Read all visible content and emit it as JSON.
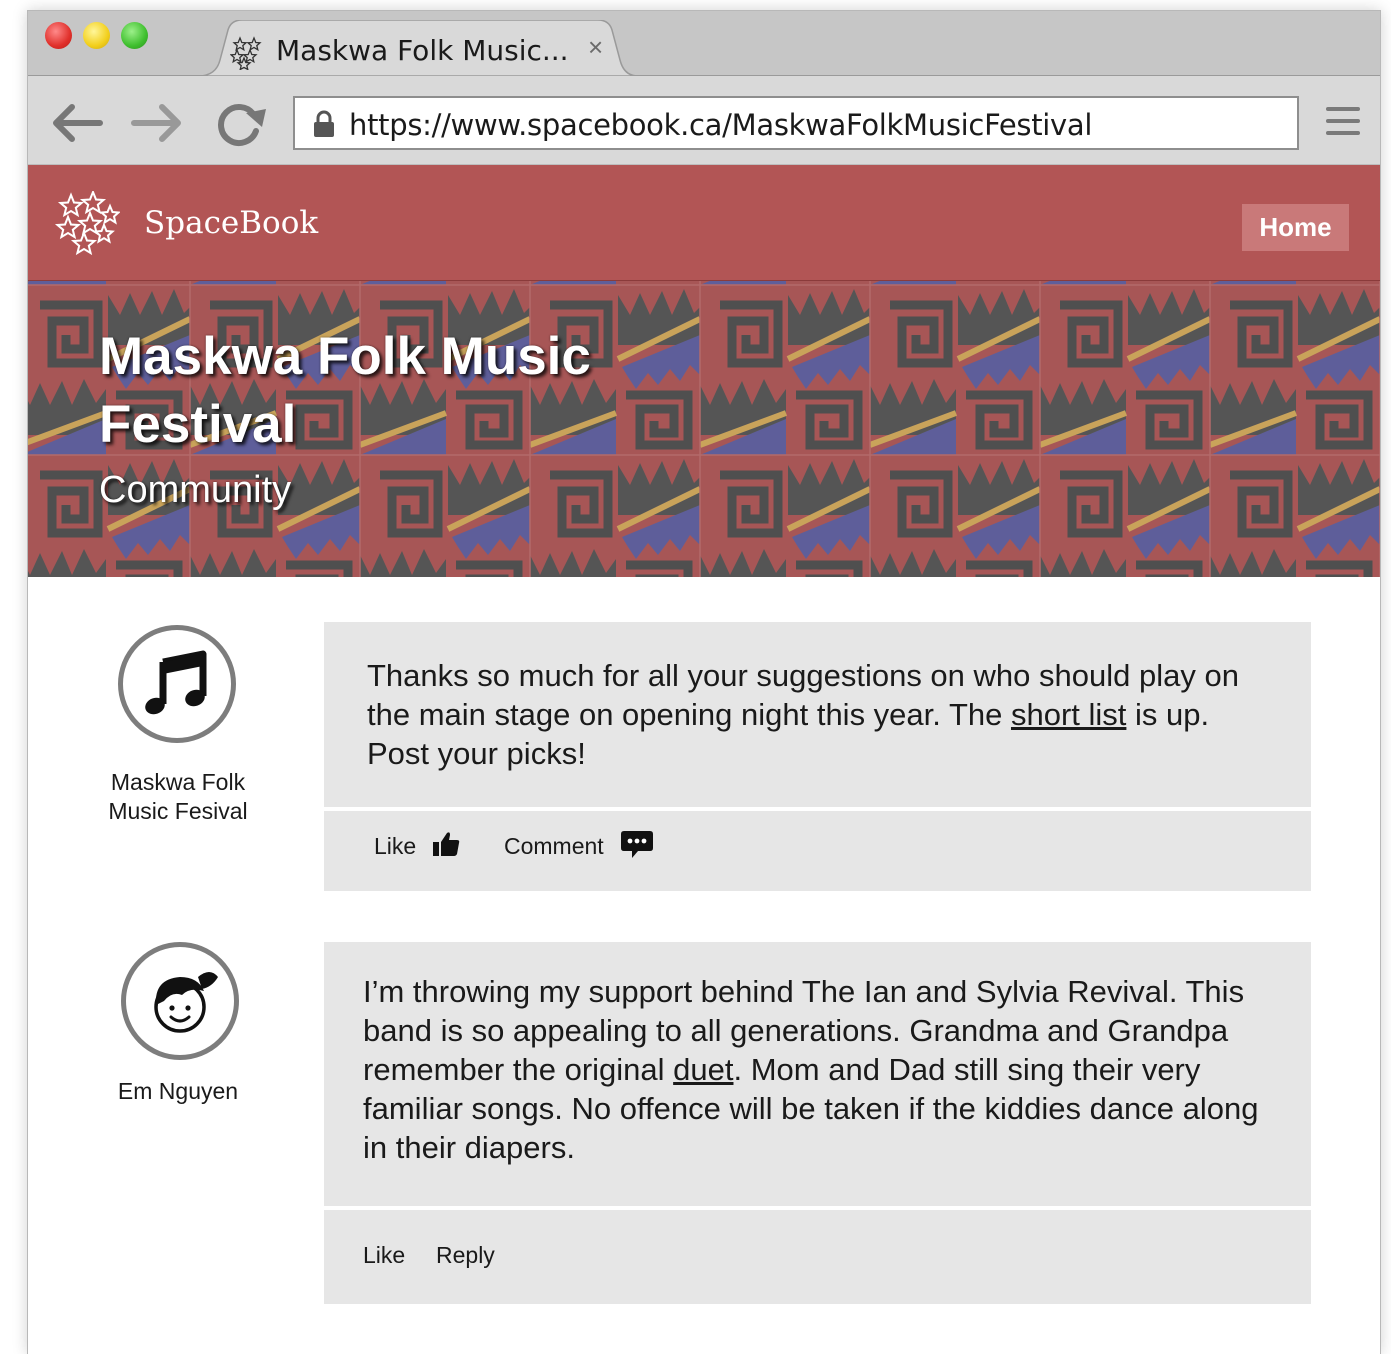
{
  "browser": {
    "tab_title": "Maskwa Folk Music...",
    "tab_close": "×",
    "url": "https://www.spacebook.ca/MaskwaFolkMusicFestival"
  },
  "site": {
    "name": "SpaceBook",
    "nav_home": "Home",
    "accent_color": "#b25555"
  },
  "page": {
    "title_line1": "Maskwa Folk Music",
    "title_line2": "Festival",
    "category": "Community"
  },
  "posts": [
    {
      "author_line1": "Maskwa Folk",
      "author_line2": "Music Fesival",
      "avatar_icon": "music-note-icon",
      "text_before_link": "Thanks so much for all your suggestions on who should play on the main stage on opening night this year. The ",
      "link_text": "short list",
      "text_after_link": " is up. Post your picks!",
      "actions": {
        "like": "Like",
        "comment": "Comment"
      }
    },
    {
      "author": "Em Nguyen",
      "avatar_icon": "girl-face-icon",
      "text_before_link": "I’m throwing my support behind The Ian and Sylvia Revival. This band is so appealing to all generations. Grandma and Grandpa remember the original ",
      "link_text": "duet",
      "text_after_link": ". Mom and Dad still sing their very familiar songs. No offence will be taken if the kiddies dance along in their diapers.",
      "actions": {
        "like": "Like",
        "reply": "Reply"
      }
    }
  ]
}
